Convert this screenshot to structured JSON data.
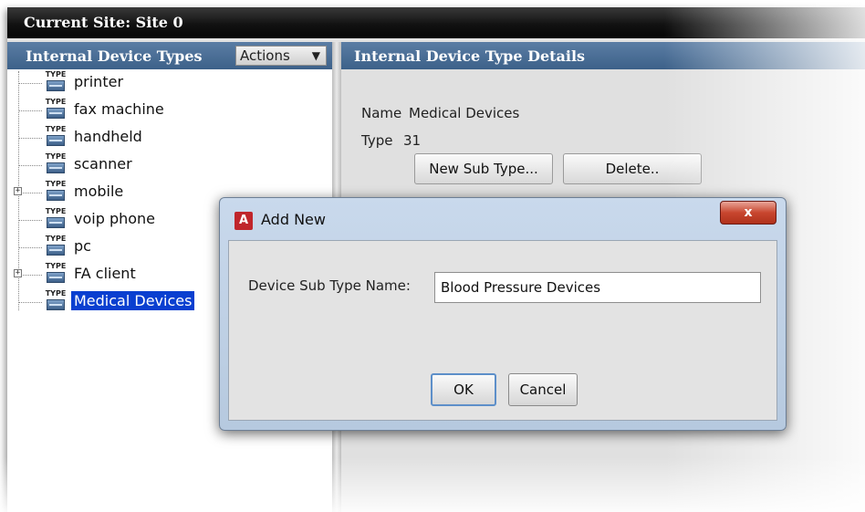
{
  "top_bar": {
    "title": "Current Site:  Site 0"
  },
  "left_panel": {
    "title": "Internal Device Types",
    "actions_label": "Actions",
    "type_icon_text": "TYPE",
    "items": [
      {
        "label": "printer",
        "expandable": false,
        "selected": false
      },
      {
        "label": "fax machine",
        "expandable": false,
        "selected": false
      },
      {
        "label": "handheld",
        "expandable": false,
        "selected": false
      },
      {
        "label": "scanner",
        "expandable": false,
        "selected": false
      },
      {
        "label": "mobile",
        "expandable": true,
        "selected": false
      },
      {
        "label": "voip phone",
        "expandable": false,
        "selected": false
      },
      {
        "label": "pc",
        "expandable": false,
        "selected": false
      },
      {
        "label": "FA client",
        "expandable": true,
        "selected": false
      },
      {
        "label": "Medical Devices",
        "expandable": false,
        "selected": true
      }
    ]
  },
  "right_panel": {
    "title": "Internal Device Type Details",
    "name_label": "Name",
    "name_value": "Medical Devices",
    "type_label": "Type",
    "type_value": "31",
    "new_sub_type_button": "New Sub Type...",
    "delete_button": "Delete.."
  },
  "dialog": {
    "app_icon": "A",
    "title": "Add New",
    "close_label": "x",
    "field_label": "Device Sub Type Name:",
    "field_value": "Blood Pressure Devices",
    "ok_button": "OK",
    "cancel_button": "Cancel"
  }
}
